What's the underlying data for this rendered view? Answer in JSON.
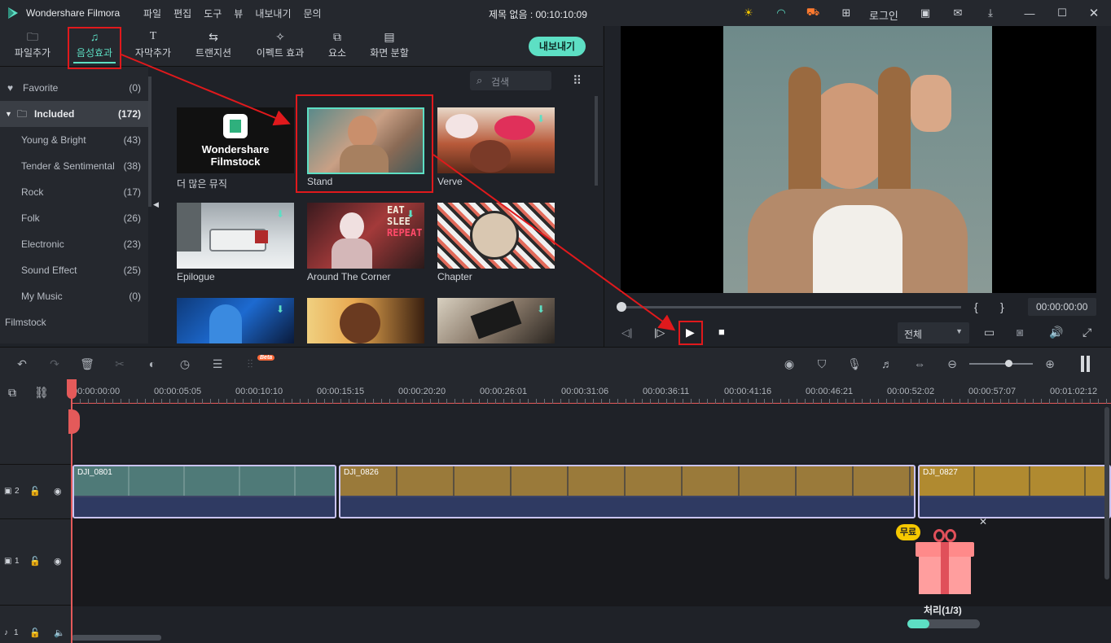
{
  "title_bar": {
    "app_name": "Wondershare Filmora",
    "menu": [
      "파일",
      "편집",
      "도구",
      "뷰",
      "내보내기",
      "문의"
    ],
    "document_title": "제목 없음 : 00:10:10:09",
    "login": "로그인"
  },
  "toolbar": {
    "tabs": [
      "파일추가",
      "음성효과",
      "자막추가",
      "트랜지션",
      "이펙트 효과",
      "요소",
      "화면 분할"
    ],
    "export": "내보내기"
  },
  "sidebar": {
    "favorite": {
      "label": "Favorite",
      "count": "(0)"
    },
    "included": {
      "label": "Included",
      "count": "(172)"
    },
    "items": [
      {
        "label": "Young & Bright",
        "count": "(43)"
      },
      {
        "label": "Tender & Sentimental",
        "count": "(38)"
      },
      {
        "label": "Rock",
        "count": "(17)"
      },
      {
        "label": "Folk",
        "count": "(26)"
      },
      {
        "label": "Electronic",
        "count": "(23)"
      },
      {
        "label": "Sound Effect",
        "count": "(25)"
      },
      {
        "label": "My Music",
        "count": "(0)"
      }
    ],
    "filmstock": "Filmstock"
  },
  "library": {
    "search_placeholder": "검색",
    "filmstock_line1": "Wondershare",
    "filmstock_line2": "Filmstock",
    "items": [
      "더 많은 뮤직",
      "Stand",
      "Verve",
      "Epilogue",
      "Around The Corner",
      "Chapter"
    ],
    "overlay_text": [
      "EAT",
      "SLEE",
      "REPEAT"
    ]
  },
  "preview": {
    "mark_in": "{",
    "mark_out": "}",
    "timecode": "00:00:00:00",
    "quality": "전체"
  },
  "timeline": {
    "beta": "Beta",
    "ruler": [
      "00:00:00:00",
      "00:00:05:05",
      "00:00:10:10",
      "00:00:15:15",
      "00:00:20:20",
      "00:00:26:01",
      "00:00:31:06",
      "00:00:36:11",
      "00:00:41:16",
      "00:00:46:21",
      "00:00:52:02",
      "00:00:57:07",
      "00:01:02:12"
    ],
    "tracks": [
      {
        "label": "2"
      },
      {
        "label": "1"
      },
      {
        "label": "1"
      }
    ],
    "clips": [
      "DJI_0801",
      "DJI_0826",
      "DJI_0827"
    ]
  },
  "promo": {
    "badge": "무료",
    "status": "처리(1/3)",
    "progress": 0.3
  },
  "colors": {
    "accent": "#5ddfc4",
    "highlight": "#e0191c",
    "playhead": "#e45a5a"
  }
}
